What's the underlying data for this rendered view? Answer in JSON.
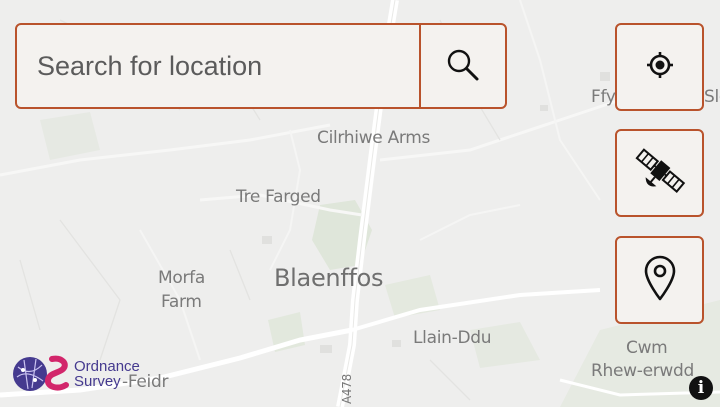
{
  "search": {
    "placeholder": "Search for location",
    "button_icon": "search-icon"
  },
  "controls": [
    {
      "icon": "locate-icon"
    },
    {
      "icon": "satellite-icon"
    },
    {
      "icon": "map-pin-icon"
    }
  ],
  "map": {
    "places": [
      {
        "name": "Cilrhiwe Arms"
      },
      {
        "name": "Tre Farged"
      },
      {
        "name": "Morfa"
      },
      {
        "name": "Farm"
      },
      {
        "name": "Blaenffos"
      },
      {
        "name": "Llain-Ddu"
      },
      {
        "name": "Cwm"
      },
      {
        "name": "Rhew-erwdd"
      },
      {
        "name": "Ffy"
      },
      {
        "name": "Sle"
      },
      {
        "name": "-Feidr"
      },
      {
        "name": "A478"
      }
    ]
  },
  "attribution": {
    "logo_text_line1": "Ordnance",
    "logo_text_line2": "Survey",
    "info_icon": "info-icon"
  },
  "colors": {
    "accent": "#b9532c",
    "map_background": "#eeeeed",
    "logo_purple": "#453a8f",
    "logo_pink": "#d2266b"
  }
}
